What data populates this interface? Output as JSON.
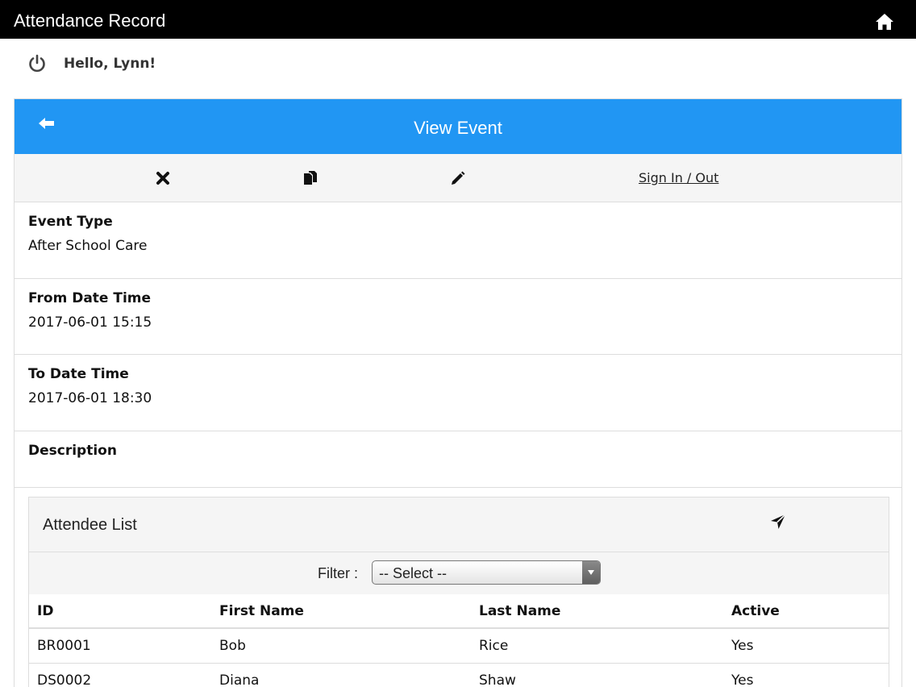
{
  "app": {
    "title": "Attendance Record"
  },
  "greeting": {
    "text": "Hello, Lynn!"
  },
  "page": {
    "title": "View Event"
  },
  "toolbar": {
    "sign_in_out": "Sign In / Out"
  },
  "fields": [
    {
      "label": "Event Type",
      "value": "After School Care"
    },
    {
      "label": "From Date Time",
      "value": "2017-06-01 15:15"
    },
    {
      "label": "To Date Time",
      "value": "2017-06-01 18:30"
    },
    {
      "label": "Description",
      "value": ""
    }
  ],
  "attendees": {
    "title": "Attendee List",
    "filter_label": "Filter :",
    "filter_selected": "-- Select --",
    "columns": [
      "ID",
      "First Name",
      "Last Name",
      "Active"
    ],
    "rows": [
      [
        "BR0001",
        "Bob",
        "Rice",
        "Yes"
      ],
      [
        "DS0002",
        "Diana",
        "Shaw",
        "Yes"
      ]
    ]
  },
  "colors": {
    "header_blue": "#2196f3",
    "topbar": "#000000",
    "toolbar_bg": "#f5f5f5"
  },
  "icons": [
    "home-icon",
    "power-icon",
    "back-arrow-icon",
    "delete-icon",
    "copy-icon",
    "edit-icon",
    "send-icon"
  ]
}
